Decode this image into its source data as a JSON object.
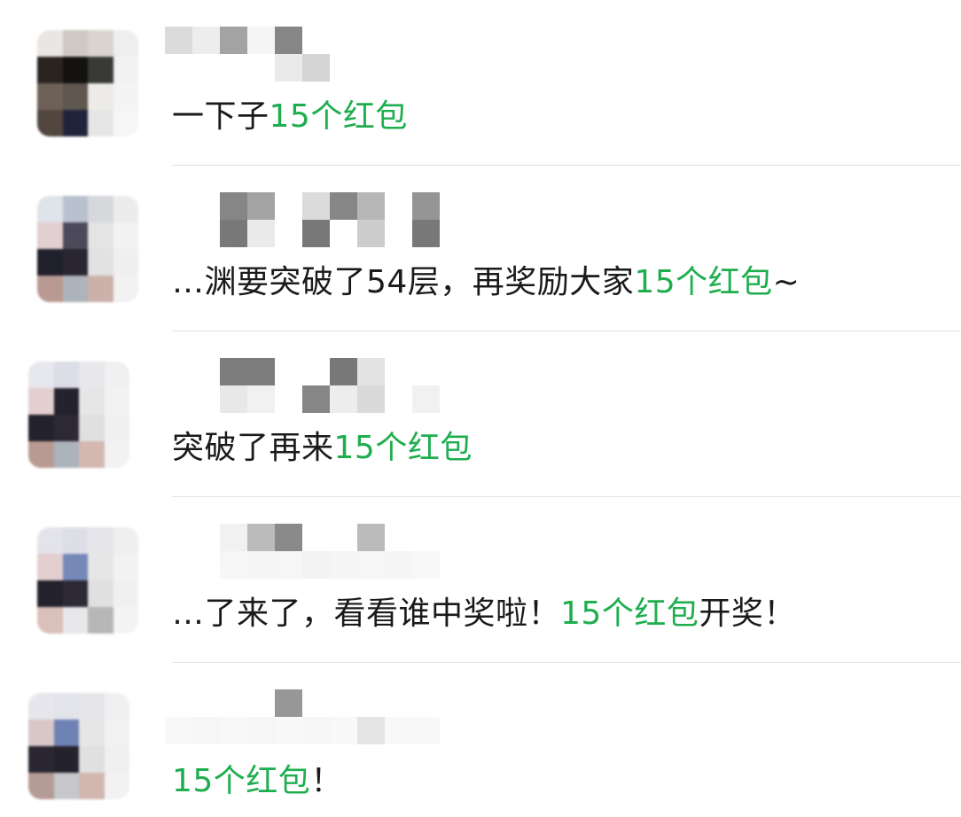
{
  "colors": {
    "highlight": "#1fae4f",
    "text": "#1a1a1a",
    "divider": "#e2e2e2"
  },
  "messages": [
    {
      "pre": "一下子",
      "highlight": "15个红包",
      "post": ""
    },
    {
      "pre": "…渊要突破了54层，再奖励大家",
      "highlight": "15个红包",
      "post": "~"
    },
    {
      "pre": "突破了再来",
      "highlight": "15个红包",
      "post": ""
    },
    {
      "pre": "…了来了，看看谁中奖啦！",
      "highlight": "15个红包",
      "post": "开奖！"
    },
    {
      "pre": "",
      "highlight": "15个红包",
      "post": "！"
    }
  ]
}
